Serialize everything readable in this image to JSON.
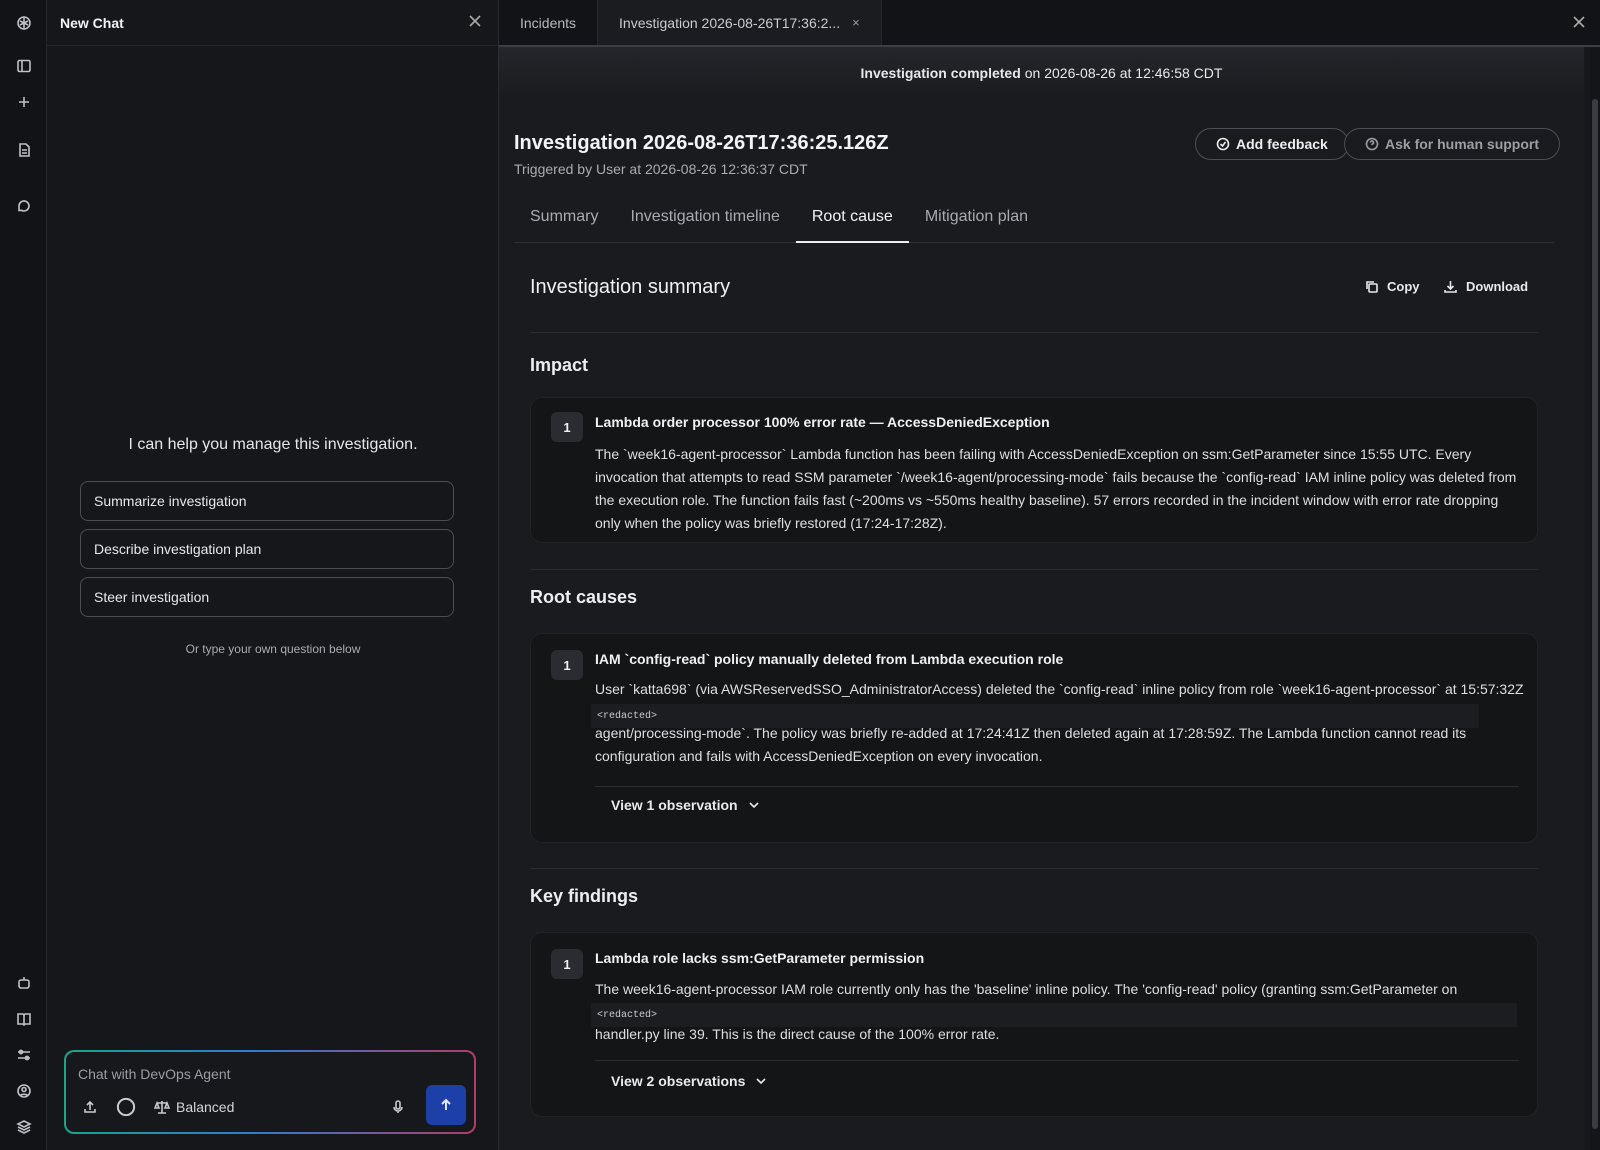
{
  "rail": {
    "icons": [
      "logo-icon",
      "sidebar-toggle-icon",
      "plus-icon",
      "document-icon",
      "chat-icon",
      "bot-icon",
      "book-icon",
      "settings-sliders-icon",
      "user-circle-icon",
      "layers-icon"
    ]
  },
  "chat": {
    "title": "New Chat",
    "intro": "I can help you manage this investigation.",
    "suggestions": [
      "Summarize investigation",
      "Describe investigation plan",
      "Steer investigation"
    ],
    "hint": "Or type your own question below",
    "placeholder": "Chat with DevOps Agent",
    "mode": "Balanced"
  },
  "main": {
    "tabs": [
      {
        "label": "Incidents"
      },
      {
        "label": "Investigation 2026-08-26T17:36:2...",
        "close": "×"
      }
    ],
    "banner": {
      "bold": "Investigation completed",
      "rest": "on 2026-08-26 at 12:46:58 CDT"
    },
    "title": "Investigation 2026-08-26T17:36:25.126Z",
    "subtitle": "Triggered by User at 2026-08-26 12:36:37 CDT",
    "add_feedback": "Add feedback",
    "human_support": "Ask for human support",
    "subtabs": [
      "Summary",
      "Investigation timeline",
      "Root cause",
      "Mitigation plan"
    ],
    "active_subtab": "Root cause",
    "summary_title": "Investigation summary",
    "copy": "Copy",
    "download": "Download",
    "impact": {
      "heading": "Impact",
      "num": "1",
      "title": "Lambda order processor 100% error rate — AccessDeniedException",
      "body": "The `week16-agent-processor` Lambda function has been failing with AccessDeniedException on ssm:GetParameter since 15:55 UTC. Every invocation that attempts to read SSM parameter `/week16-agent/processing-mode` fails because the `config-read` IAM inline policy was deleted from the execution role. The function fails fast (~200ms vs ~550ms healthy baseline). 57 errors recorded in the incident window with error rate dropping only when the policy was briefly restored (17:24-17:28Z)."
    },
    "root_causes": {
      "heading": "Root causes",
      "num": "1",
      "title": "IAM `config-read` policy manually deleted from Lambda execution role",
      "body1": "User `katta698` (via AWSReservedSSO_AdministratorAccess) deleted the `config-read` inline policy from role `week16-agent-processor` at 15:57:32Z",
      "redacted": "<redacted>",
      "body2": "agent/processing-mode`. The policy was briefly re-added at 17:24:41Z then deleted again at 17:28:59Z. The Lambda function cannot read its configuration and fails with AccessDeniedException on every invocation.",
      "observations": "View 1 observation"
    },
    "key_findings": {
      "heading": "Key findings",
      "num": "1",
      "title": "Lambda role lacks ssm:GetParameter permission",
      "body1": "The week16-agent-processor IAM role currently only has the 'baseline' inline policy. The 'config-read' policy (granting ssm:GetParameter on",
      "redacted": "<redacted>",
      "body2": "handler.py line 39. This is the direct cause of the 100% error rate.",
      "observations": "View 2 observations"
    }
  }
}
